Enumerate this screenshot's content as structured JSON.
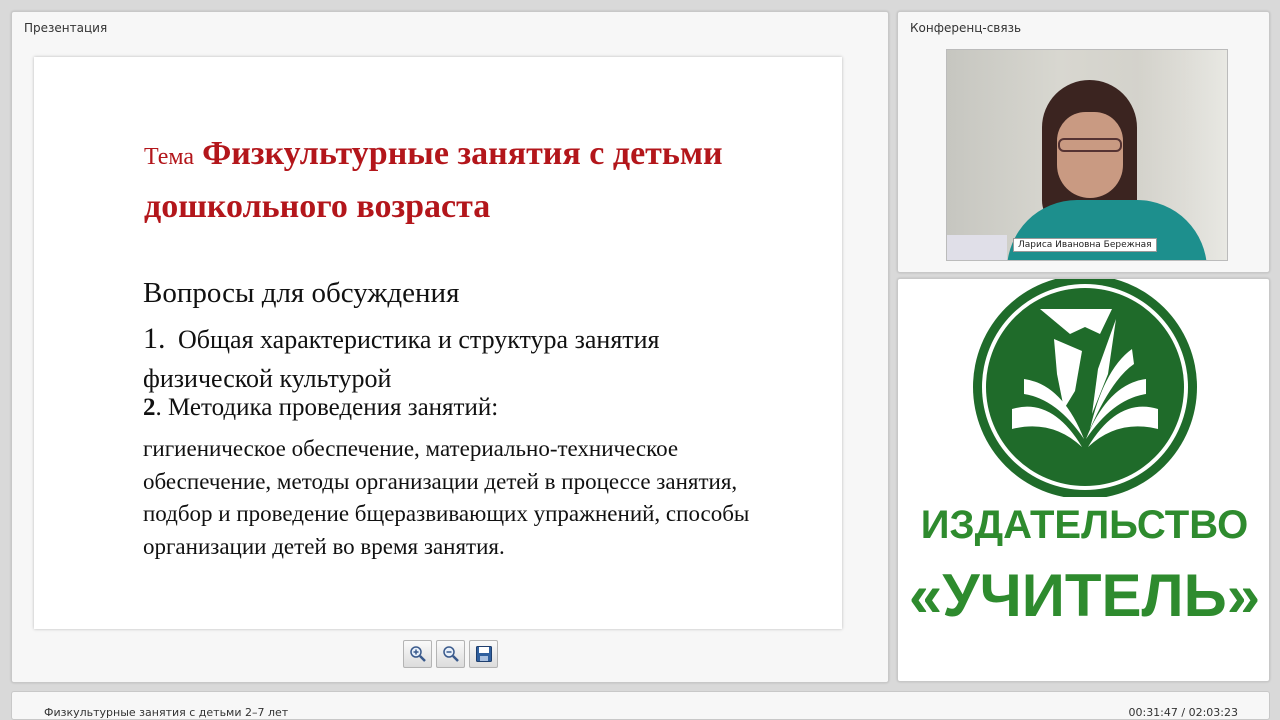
{
  "presentation_panel": {
    "title": "Презентация"
  },
  "slide": {
    "topic_word": "Тема",
    "topic_title": "Физкультурные занятия с детьми дошкольного возраста",
    "questions_heading": "Вопросы для обсуждения",
    "q1_number": "1.",
    "q1_text": "Общая  характеристика  и структура занятия  физической культурой",
    "q2_number": "2",
    "q2_text": ". Методика проведения занятий:",
    "q2_details": " гигиеническое обеспечение, материально-техническое обеспечение,  методы организации детей в процессе занятия, подбор и проведение бщеразвивающих упражнений, способы организации детей во время занятия."
  },
  "toolbar": {
    "icons": [
      "zoom-in-icon",
      "zoom-out-icon",
      "save-icon"
    ]
  },
  "conference_panel": {
    "title": "Конференц-связь",
    "participant_name": "Лариса Ивановна Бережная"
  },
  "logo": {
    "line1": "ИЗДАТЕЛЬСТВО",
    "line2": "«УЧИТЕЛЬ»",
    "color": "#2e8b2e"
  },
  "footer": {
    "title": "Физкультурные занятия с детьми 2–7 лет",
    "time": "00:31:47 / 02:03:23"
  }
}
